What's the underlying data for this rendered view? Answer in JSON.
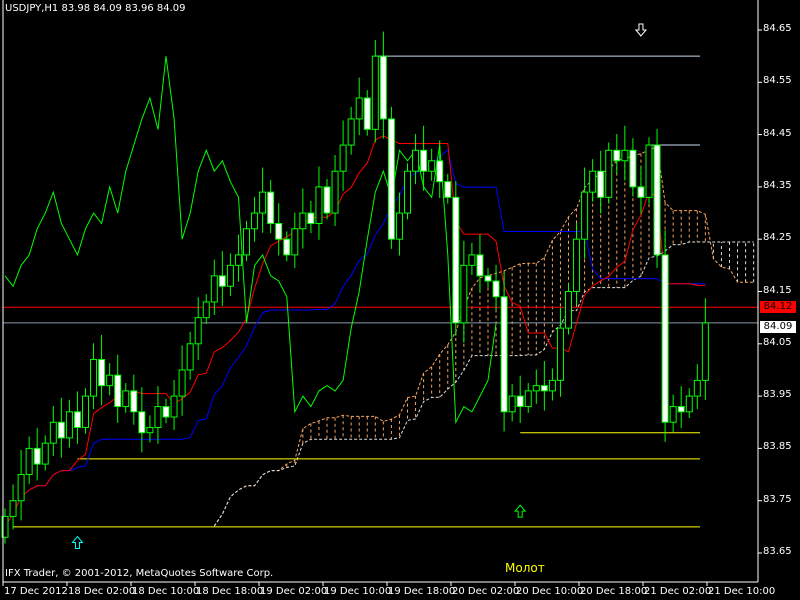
{
  "header": {
    "title": "USDJPY,H1  83.98 84.09 83.96 84.09"
  },
  "footer": {
    "copyright": "IFX Trader, © 2001-2012, MetaQuotes Software Corp."
  },
  "annotations": {
    "pattern_label": "Молот"
  },
  "colors": {
    "background": "#000000",
    "bull_outline": "#00ff00",
    "bear_body": "#ffffff",
    "tenkan": "#ff0000",
    "kijun": "#0000ff",
    "chikou": "#00ff00",
    "cloud": "#f4a460",
    "cloud_alt": "#e0e0e0",
    "support": "#ffff00",
    "resistance": "#c8dcf0",
    "bid_line": "#ff0000",
    "last_line": "#8899aa"
  },
  "chart_data": {
    "type": "candlestick",
    "symbol": "USDJPY",
    "timeframe": "H1",
    "ylim": [
      83.62,
      84.68
    ],
    "y_ticks": [
      "84.65",
      "84.55",
      "84.45",
      "84.35",
      "84.25",
      "84.15",
      "84.05",
      "83.95",
      "83.85",
      "83.75",
      "83.65"
    ],
    "x_ticks": [
      "17 Dec 2012",
      "18 Dec 02:00",
      "18 Dec 10:00",
      "18 Dec 18:00",
      "19 Dec 02:00",
      "19 Dec 10:00",
      "19 Dec 18:00",
      "20 Dec 02:00",
      "20 Dec 10:00",
      "20 Dec 18:00",
      "21 Dec 02:00",
      "21 Dec 10:00"
    ],
    "closes": [
      83.72,
      83.75,
      83.8,
      83.85,
      83.82,
      83.86,
      83.9,
      83.87,
      83.92,
      83.89,
      83.95,
      84.02,
      83.97,
      83.99,
      83.93,
      83.96,
      83.92,
      83.88,
      83.89,
      83.93,
      83.91,
      83.95,
      84.0,
      84.05,
      84.1,
      84.13,
      84.18,
      84.16,
      84.2,
      84.22,
      84.27,
      84.3,
      84.34,
      84.28,
      84.25,
      84.22,
      84.27,
      84.3,
      84.28,
      84.35,
      84.3,
      84.38,
      84.43,
      84.48,
      84.52,
      84.46,
      84.6,
      84.48,
      84.25,
      84.3,
      84.38,
      84.42,
      84.38,
      84.4,
      84.36,
      84.33,
      84.09,
      84.2,
      84.22,
      84.18,
      84.17,
      84.14,
      83.92,
      83.95,
      83.93,
      83.96,
      83.97,
      83.96,
      83.98,
      84.08,
      84.15,
      84.25,
      84.34,
      84.38,
      84.33,
      84.42,
      84.4,
      84.42,
      84.35,
      84.33,
      84.43,
      84.22,
      83.9,
      83.93,
      83.92,
      83.95,
      83.98,
      84.09
    ],
    "first_open": 83.68,
    "bid_price": "84.12",
    "last_price": "84.09",
    "hlines": [
      {
        "price": 83.83,
        "from_bar": 9,
        "role": "support"
      },
      {
        "price": 83.7,
        "from_bar": 1,
        "role": "support"
      },
      {
        "price": 83.88,
        "from_bar": 64,
        "role": "support"
      },
      {
        "price": 84.6,
        "from_bar": 46,
        "role": "resistance"
      },
      {
        "price": 84.43,
        "from_bar": 80,
        "role": "resistance"
      }
    ],
    "arrows": [
      {
        "bar": 9,
        "price": 83.67,
        "dir": "up",
        "color": "#00ffff"
      },
      {
        "bar": 64,
        "price": 83.73,
        "dir": "up",
        "color": "#00ff00"
      },
      {
        "bar": 79,
        "price": 84.65,
        "dir": "down",
        "color": "#ffffff"
      }
    ],
    "indicator": "Ichimoku (9,26,52)"
  }
}
